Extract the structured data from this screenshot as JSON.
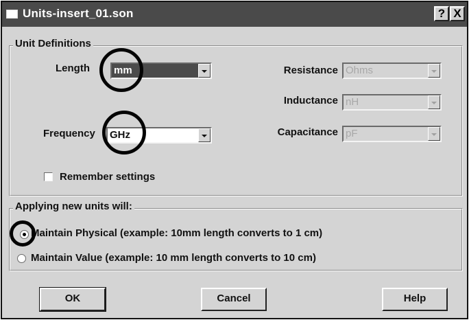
{
  "window": {
    "title": "Units-insert_01.son",
    "help_glyph": "?",
    "close_glyph": "X"
  },
  "unit_definitions": {
    "legend": "Unit Definitions",
    "length": {
      "label": "Length",
      "value": "mm"
    },
    "frequency": {
      "label": "Frequency",
      "value": "GHz"
    },
    "resistance": {
      "label": "Resistance",
      "value": "Ohms"
    },
    "inductance": {
      "label": "Inductance",
      "value": "nH"
    },
    "capacitance": {
      "label": "Capacitance",
      "value": "pF"
    },
    "remember": {
      "label": "Remember settings",
      "checked": false
    }
  },
  "applying": {
    "legend": "Applying new units will:",
    "options": [
      {
        "label": "Maintain Physical (example: 10mm length converts to 1 cm)",
        "selected": true
      },
      {
        "label": "Maintain Value (example: 10 mm length converts to 10 cm)",
        "selected": false
      }
    ]
  },
  "buttons": {
    "ok": "OK",
    "cancel": "Cancel",
    "help": "Help"
  },
  "colors": {
    "title_bar": "#4a4a4a",
    "dialog_bg": "#d4d4d4",
    "highlight_circle": "#050505"
  }
}
